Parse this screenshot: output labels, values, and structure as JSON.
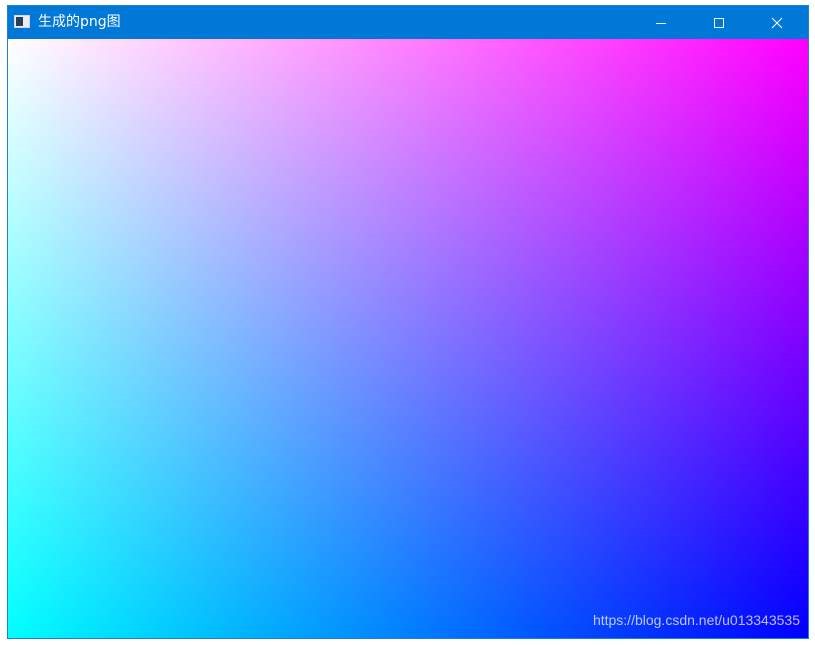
{
  "window": {
    "title": "生成的png图"
  },
  "controls": {
    "minimize_icon": "minimize-icon",
    "maximize_icon": "maximize-icon",
    "close_icon": "close-icon"
  },
  "canvas": {
    "gradient_colors": {
      "top_left": "#ffffff",
      "top_right": "#ff00ff",
      "bottom_left": "#00ffff",
      "bottom_right": "#0000ff"
    }
  },
  "watermark": {
    "text": "https://blog.csdn.net/u013343535"
  }
}
